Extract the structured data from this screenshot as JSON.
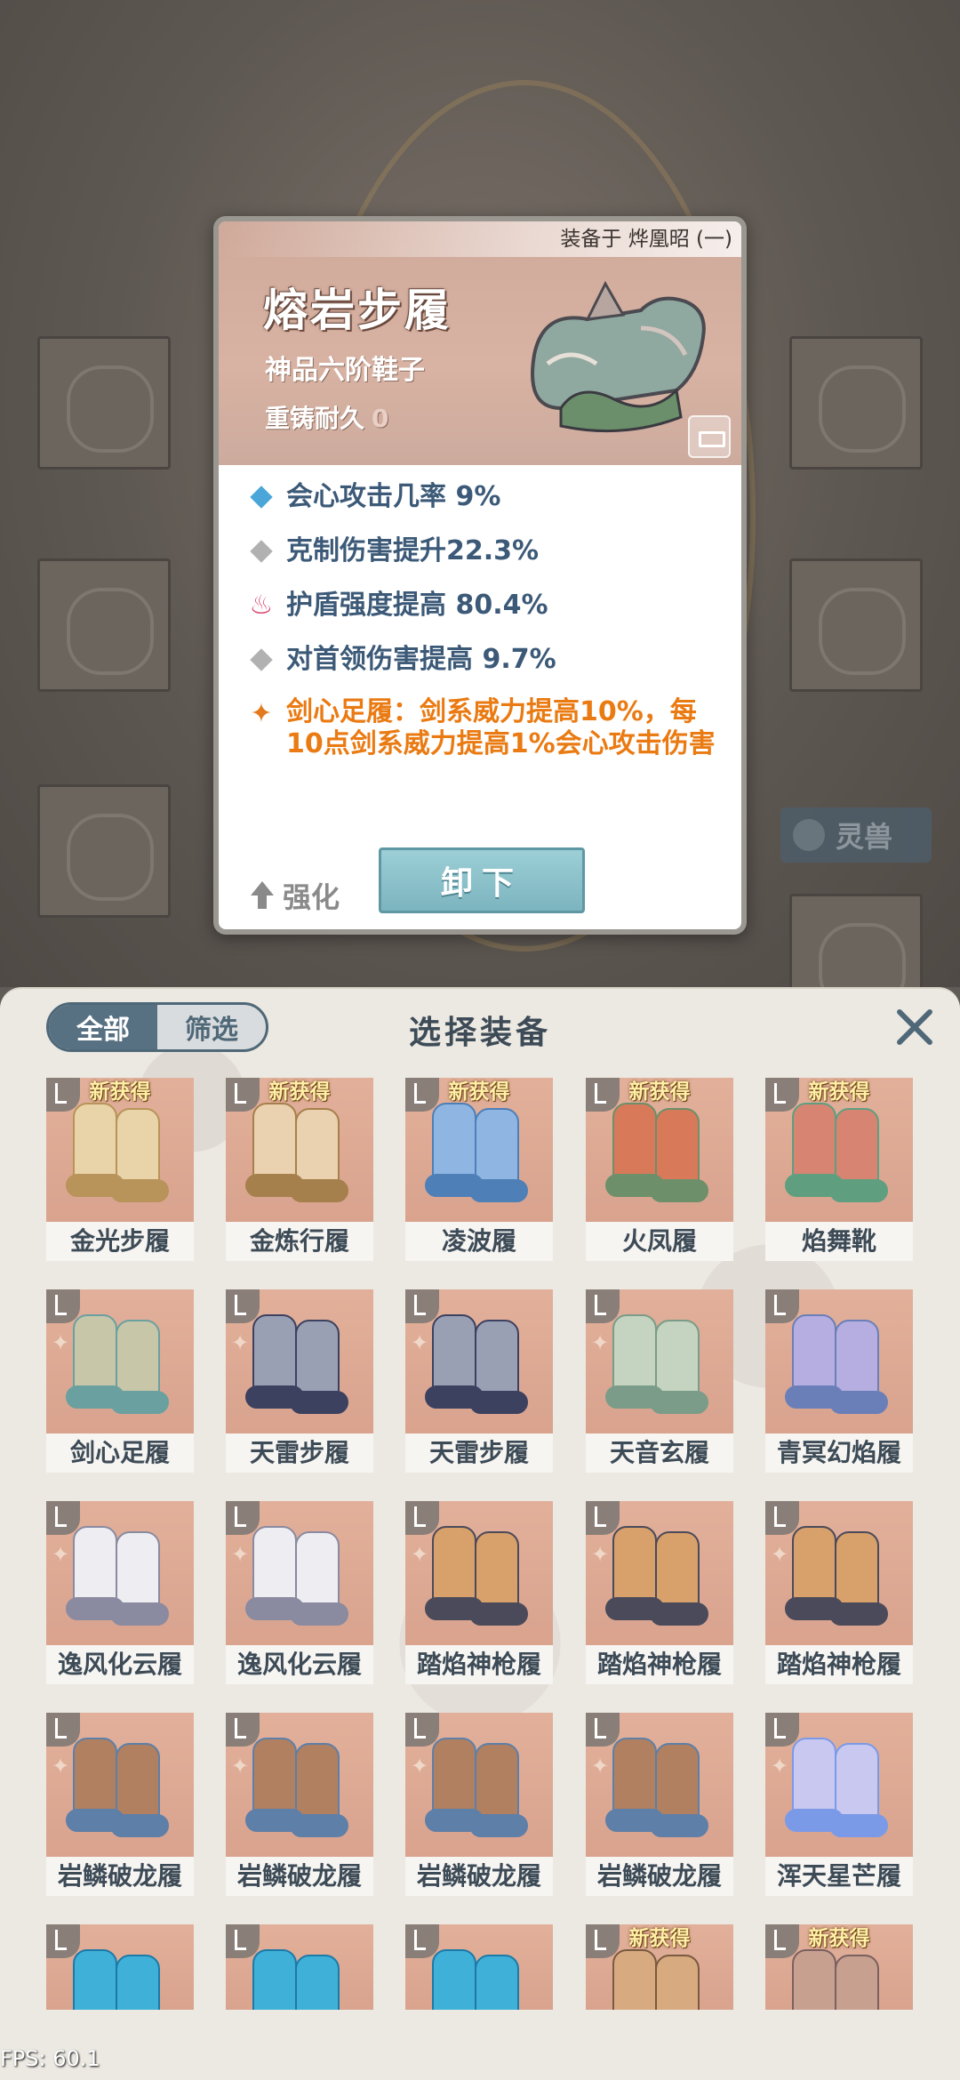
{
  "background": {
    "pet_label": "灵兽"
  },
  "detail": {
    "equipped_by": "装备于 烨凰昭 (一)",
    "name": "熔岩步履",
    "grade": "神品六阶鞋子",
    "durability_label": "重铸耐久",
    "durability_value": "0",
    "stats": [
      {
        "icon": "blue-diamond-icon",
        "text": "会心攻击几率 9%"
      },
      {
        "icon": "gray-diamond-icon",
        "text": "克制伤害提升22.3%"
      },
      {
        "icon": "flame-icon",
        "text": "护盾强度提高 80.4%"
      },
      {
        "icon": "gray-diamond-icon",
        "text": "对首领伤害提高 9.7%"
      }
    ],
    "set_bonus": "剑心足履：剑系威力提高10%，每10点剑系威力提高1%会心攻击伤害",
    "strengthen_label": "强化",
    "unequip_label": "卸下",
    "colors": {
      "header": "#d6ad9d",
      "stat_text": "#3c5a78",
      "set_text": "#ea7a12"
    }
  },
  "panel": {
    "tab_all": "全部",
    "tab_filter": "筛选",
    "title": "选择装备",
    "new_badge": "新获得",
    "items": [
      {
        "name": "金光步履",
        "new": true,
        "set": false,
        "color": "#e8d4a8",
        "accent": "#b8935a"
      },
      {
        "name": "金炼行履",
        "new": true,
        "set": false,
        "color": "#ead2b0",
        "accent": "#a6804c"
      },
      {
        "name": "凌波履",
        "new": true,
        "set": false,
        "color": "#8fb6e2",
        "accent": "#4e7fb7"
      },
      {
        "name": "火凤履",
        "new": true,
        "set": false,
        "color": "#d87a5a",
        "accent": "#6d8f6a"
      },
      {
        "name": "焰舞靴",
        "new": true,
        "set": false,
        "color": "#d88472",
        "accent": "#5f9f80"
      },
      {
        "name": "剑心足履",
        "new": false,
        "set": true,
        "color": "#c8c6a8",
        "accent": "#6aa0a0"
      },
      {
        "name": "天雷步履",
        "new": false,
        "set": true,
        "color": "#9aa0b4",
        "accent": "#3c4160"
      },
      {
        "name": "天雷步履",
        "new": false,
        "set": true,
        "color": "#9aa0b4",
        "accent": "#3c4160"
      },
      {
        "name": "天音玄履",
        "new": false,
        "set": true,
        "color": "#c4d4c0",
        "accent": "#7a9c88"
      },
      {
        "name": "青冥幻焰履",
        "new": false,
        "set": false,
        "color": "#b6aee0",
        "accent": "#6a7fb8"
      },
      {
        "name": "逸风化云履",
        "new": false,
        "set": true,
        "color": "#eeeef2",
        "accent": "#8a8aa0"
      },
      {
        "name": "逸风化云履",
        "new": false,
        "set": true,
        "color": "#eeeef2",
        "accent": "#8a8aa0"
      },
      {
        "name": "踏焰神枪履",
        "new": false,
        "set": true,
        "color": "#d8a06a",
        "accent": "#4a4a5a"
      },
      {
        "name": "踏焰神枪履",
        "new": false,
        "set": true,
        "color": "#d8a06a",
        "accent": "#4a4a5a"
      },
      {
        "name": "踏焰神枪履",
        "new": false,
        "set": true,
        "color": "#d8a06a",
        "accent": "#4a4a5a"
      },
      {
        "name": "岩鳞破龙履",
        "new": false,
        "set": true,
        "color": "#b08060",
        "accent": "#5e7fa8"
      },
      {
        "name": "岩鳞破龙履",
        "new": false,
        "set": true,
        "color": "#b08060",
        "accent": "#5e7fa8"
      },
      {
        "name": "岩鳞破龙履",
        "new": false,
        "set": true,
        "color": "#b08060",
        "accent": "#5e7fa8"
      },
      {
        "name": "岩鳞破龙履",
        "new": false,
        "set": true,
        "color": "#b08060",
        "accent": "#5e7fa8"
      },
      {
        "name": "浑天星芒履",
        "new": false,
        "set": true,
        "color": "#c8c8f0",
        "accent": "#7a9ae8"
      },
      {
        "name": "",
        "new": false,
        "set": false,
        "color": "#3fb0d8",
        "accent": "#1c7aa8"
      },
      {
        "name": "",
        "new": false,
        "set": false,
        "color": "#3fb0d8",
        "accent": "#1c7aa8"
      },
      {
        "name": "",
        "new": false,
        "set": false,
        "color": "#3fb0d8",
        "accent": "#1c7aa8"
      },
      {
        "name": "",
        "new": true,
        "set": false,
        "color": "#d8aa80",
        "accent": "#7a5a40"
      },
      {
        "name": "",
        "new": true,
        "set": false,
        "color": "#c8a090",
        "accent": "#7a6060"
      }
    ]
  },
  "fps": "FPS: 60.1"
}
